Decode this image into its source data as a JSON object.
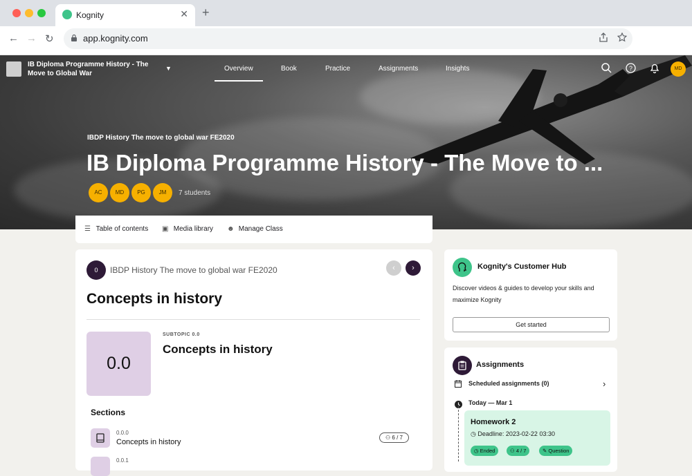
{
  "browser": {
    "tab_title": "Kognity",
    "tab_close": "✕",
    "new_tab": "+",
    "url": "app.kognity.com",
    "back": "←",
    "forward": "→",
    "reload": "↻"
  },
  "header": {
    "course_title": "IB Diploma Programme History - The Move to Global War",
    "nav": [
      "Overview",
      "Book",
      "Practice",
      "Assignments",
      "Insights"
    ],
    "active_nav": "Overview",
    "user_initials": "MD"
  },
  "hero": {
    "class_name": "IBDP History The move to global war FE2020",
    "title": "IB Diploma Programme History - The Move to ...",
    "students": [
      "AC",
      "MD",
      "PG",
      "JM"
    ],
    "student_count": "7 students"
  },
  "subbar": {
    "items": [
      "Table of contents",
      "Media library",
      "Manage Class"
    ]
  },
  "main": {
    "badge": "0",
    "crumb": "IBDP History The move to global war FE2020",
    "heading": "Concepts in history",
    "tile_number": "0.0",
    "subtopic_label": "SUBTOPIC 0.0",
    "subtopic_title": "Concepts in history",
    "sections_label": "Sections",
    "sections": [
      {
        "number": "0.0.0",
        "title": "Concepts in history",
        "progress": "6 / 7"
      },
      {
        "number": "0.0.1",
        "title": ""
      }
    ]
  },
  "hub": {
    "title": "Kognity's Customer Hub",
    "description": "Discover videos & guides to develop your skills and maximize Kognity",
    "button": "Get started"
  },
  "assignments": {
    "title": "Assignments",
    "scheduled": "Scheduled assignments (0)",
    "today": "Today — Mar 1",
    "homework": {
      "title": "Homework 2",
      "deadline": "Deadline: 2023-02-22 03:30",
      "tags": [
        "Ended",
        "4 / 7",
        "Question"
      ]
    }
  },
  "colors": {
    "accent_green": "#3ec48a",
    "dark_purple": "#2e1a37",
    "avatar_yellow": "#f6b000",
    "tile_lavender": "#dfcfe5"
  }
}
